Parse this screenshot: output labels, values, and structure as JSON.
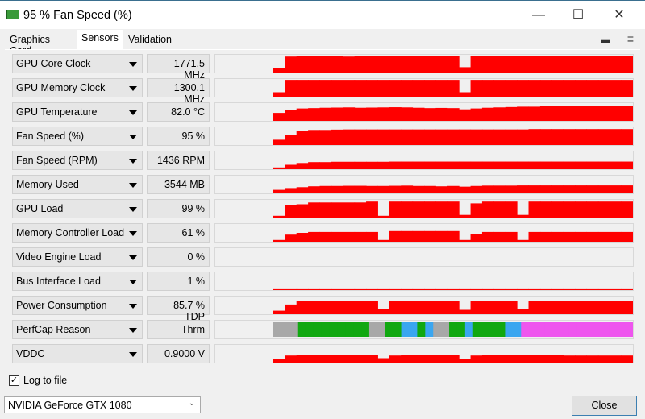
{
  "window": {
    "title": "95 % Fan Speed (%)",
    "minimize": "—",
    "maximize": "☐",
    "close": "✕"
  },
  "tabs": [
    {
      "label": "Graphics Card"
    },
    {
      "label": "Sensors",
      "active": true
    },
    {
      "label": "Validation"
    }
  ],
  "menu": {
    "screenshot_icon": "camera-icon",
    "menu_icon": "hamburger-icon",
    "camera_glyph": "▬",
    "menu_glyph": "≡"
  },
  "colors": {
    "graph": "#ff0000",
    "perfcap": {
      "idle": "#a8a8a8",
      "vrel": "#11a811",
      "util": "#3aa6f0",
      "pwr": "#ee55ee"
    }
  },
  "sensors": [
    {
      "name": "GPU Core Clock",
      "value": "1771.5 MHz",
      "history": [
        null,
        null,
        null,
        null,
        null,
        0.25,
        0.9,
        0.95,
        0.95,
        0.95,
        0.95,
        0.9,
        0.95,
        0.95,
        0.95,
        0.95,
        0.95,
        0.95,
        0.95,
        0.95,
        0.95,
        0.3,
        0.95,
        0.95,
        0.95,
        0.95,
        0.95,
        0.95,
        0.95,
        0.95,
        0.95,
        0.95,
        0.95,
        0.95,
        0.95,
        0.95
      ]
    },
    {
      "name": "GPU Memory Clock",
      "value": "1300.1 MHz",
      "history": [
        null,
        null,
        null,
        null,
        null,
        0.25,
        0.95,
        0.95,
        0.95,
        0.95,
        0.95,
        0.95,
        0.95,
        0.95,
        0.95,
        0.95,
        0.95,
        0.95,
        0.95,
        0.95,
        0.95,
        0.25,
        0.95,
        0.95,
        0.95,
        0.95,
        0.95,
        0.95,
        0.95,
        0.95,
        0.95,
        0.95,
        0.95,
        0.95,
        0.95,
        0.95
      ]
    },
    {
      "name": "GPU Temperature",
      "value": "82.0 °C",
      "history": [
        null,
        null,
        null,
        null,
        null,
        0.45,
        0.6,
        0.7,
        0.72,
        0.74,
        0.75,
        0.76,
        0.74,
        0.75,
        0.76,
        0.77,
        0.76,
        0.74,
        0.72,
        0.73,
        0.72,
        0.65,
        0.7,
        0.74,
        0.76,
        0.78,
        0.8,
        0.8,
        0.82,
        0.83,
        0.83,
        0.84,
        0.84,
        0.85,
        0.85,
        0.85
      ]
    },
    {
      "name": "Fan Speed (%)",
      "value": "95 %",
      "history": [
        null,
        null,
        null,
        null,
        null,
        0.3,
        0.55,
        0.8,
        0.85,
        0.85,
        0.87,
        0.88,
        0.88,
        0.88,
        0.88,
        0.88,
        0.88,
        0.88,
        0.88,
        0.88,
        0.88,
        0.88,
        0.88,
        0.88,
        0.88,
        0.88,
        0.88,
        0.9,
        0.9,
        0.9,
        0.9,
        0.9,
        0.9,
        0.9,
        0.9,
        0.9
      ]
    },
    {
      "name": "Fan Speed (RPM)",
      "value": "1436 RPM",
      "history": [
        null,
        null,
        null,
        null,
        null,
        0.1,
        0.25,
        0.35,
        0.4,
        0.4,
        0.42,
        0.42,
        0.42,
        0.42,
        0.42,
        0.43,
        0.43,
        0.43,
        0.43,
        0.43,
        0.43,
        0.43,
        0.43,
        0.43,
        0.43,
        0.43,
        0.43,
        0.43,
        0.43,
        0.43,
        0.43,
        0.43,
        0.43,
        0.43,
        0.43,
        0.43
      ]
    },
    {
      "name": "Memory Used",
      "value": "3544 MB",
      "history": [
        null,
        null,
        null,
        null,
        null,
        0.2,
        0.3,
        0.35,
        0.4,
        0.42,
        0.42,
        0.43,
        0.43,
        0.42,
        0.42,
        0.43,
        0.44,
        0.42,
        0.42,
        0.4,
        0.42,
        0.38,
        0.42,
        0.44,
        0.44,
        0.44,
        0.45,
        0.45,
        0.45,
        0.45,
        0.45,
        0.45,
        0.45,
        0.45,
        0.45,
        0.45
      ]
    },
    {
      "name": "GPU Load",
      "value": "99 %",
      "history": [
        null,
        null,
        null,
        null,
        null,
        0.1,
        0.7,
        0.75,
        0.85,
        0.85,
        0.85,
        0.85,
        0.85,
        0.9,
        0.1,
        0.9,
        0.9,
        0.9,
        0.9,
        0.9,
        0.9,
        0.15,
        0.8,
        0.9,
        0.9,
        0.9,
        0.15,
        0.9,
        0.9,
        0.9,
        0.9,
        0.9,
        0.9,
        0.9,
        0.9,
        0.9
      ]
    },
    {
      "name": "Memory Controller Load",
      "value": "61 %",
      "history": [
        null,
        null,
        null,
        null,
        null,
        0.1,
        0.4,
        0.5,
        0.55,
        0.55,
        0.55,
        0.55,
        0.55,
        0.55,
        0.1,
        0.6,
        0.6,
        0.6,
        0.6,
        0.6,
        0.6,
        0.1,
        0.45,
        0.55,
        0.55,
        0.55,
        0.1,
        0.55,
        0.55,
        0.55,
        0.55,
        0.55,
        0.55,
        0.55,
        0.55,
        0.55
      ]
    },
    {
      "name": "Video Engine Load",
      "value": "0 %",
      "history": []
    },
    {
      "name": "Bus Interface Load",
      "value": "1 %",
      "history": [
        null,
        null,
        null,
        null,
        null,
        0.05,
        0.05,
        0.05,
        0.05,
        0.05,
        0.05,
        0.05,
        0.05,
        0.05,
        0.05,
        0.05,
        0.05,
        0.05,
        0.05,
        0.05,
        0.05,
        0.05,
        0.05,
        0.05,
        0.05,
        0.05,
        0.05,
        0.05,
        0.05,
        0.05,
        0.05,
        0.05,
        0.05,
        0.05,
        0.05,
        0.05
      ]
    },
    {
      "name": "Power Consumption",
      "value": "85.7 % TDP",
      "history": [
        null,
        null,
        null,
        null,
        null,
        0.2,
        0.55,
        0.75,
        0.75,
        0.75,
        0.75,
        0.75,
        0.75,
        0.75,
        0.3,
        0.75,
        0.75,
        0.75,
        0.75,
        0.75,
        0.75,
        0.25,
        0.75,
        0.75,
        0.75,
        0.75,
        0.3,
        0.75,
        0.75,
        0.75,
        0.75,
        0.75,
        0.75,
        0.75,
        0.75,
        0.75
      ]
    },
    {
      "name": "PerfCap Reason",
      "value": "Thrm",
      "perfcap": [
        "idle",
        "idle",
        "idle",
        "vrel",
        "vrel",
        "vrel",
        "vrel",
        "vrel",
        "vrel",
        "vrel",
        "vrel",
        "vrel",
        "idle",
        "idle",
        "vrel",
        "vrel",
        "util",
        "util",
        "vrel",
        "util",
        "idle",
        "idle",
        "vrel",
        "vrel",
        "util",
        "vrel",
        "vrel",
        "vrel",
        "vrel",
        "util",
        "util",
        "pwr",
        "pwr",
        "pwr",
        "pwr",
        "pwr",
        "pwr",
        "pwr",
        "pwr",
        "pwr",
        "pwr",
        "pwr",
        "pwr",
        "pwr",
        "pwr"
      ]
    },
    {
      "name": "VDDC",
      "value": "0.9000 V",
      "history": [
        null,
        null,
        null,
        null,
        null,
        0.2,
        0.4,
        0.45,
        0.45,
        0.45,
        0.45,
        0.45,
        0.45,
        0.45,
        0.25,
        0.4,
        0.45,
        0.45,
        0.45,
        0.45,
        0.45,
        0.2,
        0.4,
        0.42,
        0.42,
        0.42,
        0.42,
        0.42,
        0.42,
        0.42,
        0.4,
        0.4,
        0.4,
        0.4,
        0.4,
        0.4
      ]
    }
  ],
  "footer": {
    "log_label": "Log to file",
    "log_checked": true,
    "gpu": "NVIDIA GeForce GTX 1080",
    "close": "Close"
  }
}
